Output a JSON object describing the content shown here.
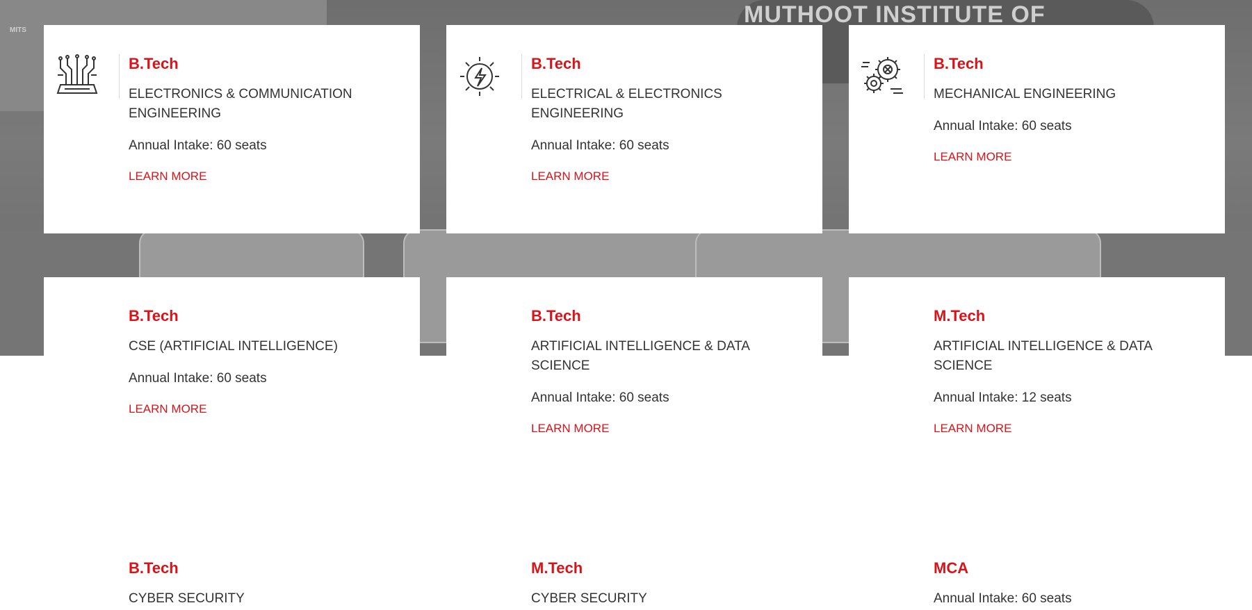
{
  "hero": {
    "sign_text": "MUTHOOT INSTITUTE OF",
    "logo_text": "MITS"
  },
  "programs": [
    {
      "degree": "B.Tech",
      "department": "ELECTRONICS & COMMUNICATION ENGINEERING",
      "intake": "Annual Intake: 60 seats",
      "link": "LEARN MORE",
      "icon": "circuit-chip-icon"
    },
    {
      "degree": "B.Tech",
      "department": "ELECTRICAL & ELECTRONICS ENGINEERING",
      "intake": "Annual Intake: 60 seats",
      "link": "LEARN MORE",
      "icon": "lightning-bolt-icon"
    },
    {
      "degree": "B.Tech",
      "department": "MECHANICAL ENGINEERING",
      "intake": "Annual Intake: 60 seats",
      "link": "LEARN MORE",
      "icon": "gears-icon"
    },
    {
      "degree": "B.Tech",
      "department": "CSE (ARTIFICIAL INTELLIGENCE)",
      "intake": "Annual Intake: 60 seats",
      "link": "LEARN MORE"
    },
    {
      "degree": "B.Tech",
      "department": "ARTIFICIAL INTELLIGENCE & DATA SCIENCE",
      "intake": "Annual Intake: 60 seats",
      "link": "LEARN MORE"
    },
    {
      "degree": "M.Tech",
      "department": "ARTIFICIAL INTELLIGENCE & DATA SCIENCE",
      "intake": "Annual Intake: 12 seats",
      "link": "LEARN MORE"
    },
    {
      "degree": "B.Tech",
      "department": "CYBER SECURITY"
    },
    {
      "degree": "M.Tech",
      "department": "CYBER SECURITY"
    },
    {
      "degree": "MCA",
      "intake": "Annual Intake: 60 seats"
    }
  ],
  "colors": {
    "accent": "#d7141a",
    "text": "#333333"
  }
}
